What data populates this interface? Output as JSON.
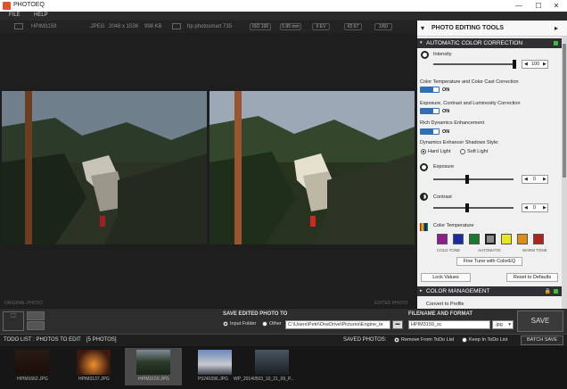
{
  "window": {
    "title": "PHOTOEQ",
    "min": "—",
    "max": "☐",
    "close": "✕"
  },
  "menu": {
    "file": "FILE",
    "help": "HELP"
  },
  "info": {
    "filename": "HPIM3159",
    "format": ".JPEG",
    "dimensions": "2048 x 1536",
    "size": "998 KB",
    "camera": "hp photosmart 735",
    "iso": "ISO 100",
    "focal": "5.95 mm",
    "ev": "0 EV",
    "aperture": "f/2.67",
    "shutter": "1/60"
  },
  "photo": {
    "left_caption": "ORIGINAL PHOTO",
    "right_caption": "EDITED PHOTO"
  },
  "panel": {
    "title": "PHOTO EDITING TOOLS",
    "auto_section": "AUTOMATIC COLOR CORRECTION",
    "intensity_label": "Intensity",
    "intensity_value": "100",
    "ct_label": "Color Temperature and Color Cast Correction",
    "ct_toggle": "ON",
    "ecl_label": "Exposure, Contrast and Luminosity Correction",
    "ecl_toggle": "ON",
    "rde_label": "Rich Dynamics Enhancement",
    "rde_toggle": "ON",
    "des_label": "Dynamics Enhancer Shadows Style:",
    "hard_light": "Hard Light",
    "soft_light": "Soft Light",
    "exposure_label": "Exposure",
    "exposure_value": "0",
    "contrast_label": "Contrast",
    "contrast_value": "0",
    "color_temp_label": "Color Temperature",
    "cold_tone": "COLD TONE",
    "automatic": "AUTOMATIC",
    "warm_tone": "WARM TONE",
    "fine_tune": "Fine Tune with ColorEQ",
    "lock_values": "Lock Values",
    "reset": "Reset to Defaults",
    "cm_section": "COLOR MANAGEMENT",
    "convert": "Convert to Profile"
  },
  "save": {
    "save_to_title": "SAVE EDITED PHOTO TO",
    "input_folder": "Input Folder",
    "other": "Other",
    "path": "C:\\Users\\Petri\\OneDrive\\Pictures\\Engine_te",
    "filename_title": "FILENAME AND FORMAT",
    "filename": "HPIM3159_sc",
    "ext": ".jpg",
    "save_button": "SAVE"
  },
  "todo": {
    "title": "TODO LIST : PHOTOS TO EDIT",
    "count": "[5 PHOTOS]",
    "saved_photos": "SAVED PHOTOS:",
    "remove": "Remove From ToDo List",
    "keep": "Keep In ToDo List",
    "batch": "BATCH SAVE"
  },
  "thumbs": [
    {
      "label": "HPIM1662.JPG"
    },
    {
      "label": "HPIM3137.JPG"
    },
    {
      "label": "HPIM3159.JPG"
    },
    {
      "label": "P5240396.JPG"
    },
    {
      "label": "WP_20140503_10_21_09_P..."
    }
  ],
  "colors": {
    "accent_blue": "#2f6fb5",
    "section_bg": "#2f2f34",
    "status_green": "#39c23f"
  },
  "swatches": [
    "#8e1d8e",
    "#1a2aa0",
    "#1b7a2a",
    "#8c8c8c",
    "#e7e71b",
    "#e08d16",
    "#b0221c"
  ]
}
